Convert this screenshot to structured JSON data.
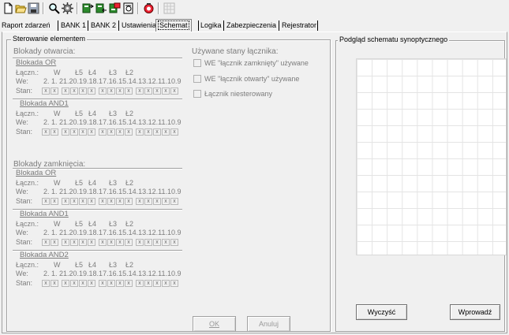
{
  "toolbar": {
    "icons": [
      "new-document-icon",
      "open-folder-icon",
      "save-icon",
      "zoom-icon",
      "settings-gear-icon",
      "send-icon",
      "receive-icon",
      "compare-icon",
      "print-preview-icon",
      "help-icon",
      "grid-icon"
    ]
  },
  "tabs": [
    {
      "label": "Raport zdarzeń"
    },
    {
      "label": "BANK 1"
    },
    {
      "label": "BANK 2"
    },
    {
      "label": "Ustawienia"
    },
    {
      "label": "Schemat",
      "active": true
    },
    {
      "label": "Logika"
    },
    {
      "label": "Zabezpieczenia"
    },
    {
      "label": "Rejestrator"
    }
  ],
  "control": {
    "title": "Sterowanie elementem",
    "opening_header": "Blokady otwarcia:",
    "closing_header": "Blokady zamknięcia:",
    "used_states_header": "Używane stany łącznika:",
    "options": [
      {
        "label": "WE \"łącznik zamknięty\" używane"
      },
      {
        "label": "WE \"łącznik otwarty\" używane"
      },
      {
        "label": "Łącznik niesterowany"
      }
    ],
    "row_labels": {
      "laczn": "Łączn.:",
      "we": "We:",
      "stan": "Stan:"
    },
    "laczn_values": [
      "W",
      "Ł5",
      "Ł4",
      "Ł3",
      "Ł2"
    ],
    "we_values": "2. 1. 21.20.19.18.17.16.15.14.13.12.11.10.9",
    "cell_mark": "x",
    "opening_blocks": [
      {
        "title": "Blokada OR"
      },
      {
        "title": "Blokada AND1"
      }
    ],
    "closing_blocks": [
      {
        "title": "Blokada OR"
      },
      {
        "title": "Blokada AND1"
      },
      {
        "title": "Blokada AND2"
      }
    ],
    "ok_label": "OK",
    "cancel_label": "Anuluj"
  },
  "preview": {
    "title": "Podgląd schematu synoptycznego",
    "clear_label": "Wyczyść",
    "enter_label": "Wprowadź"
  }
}
